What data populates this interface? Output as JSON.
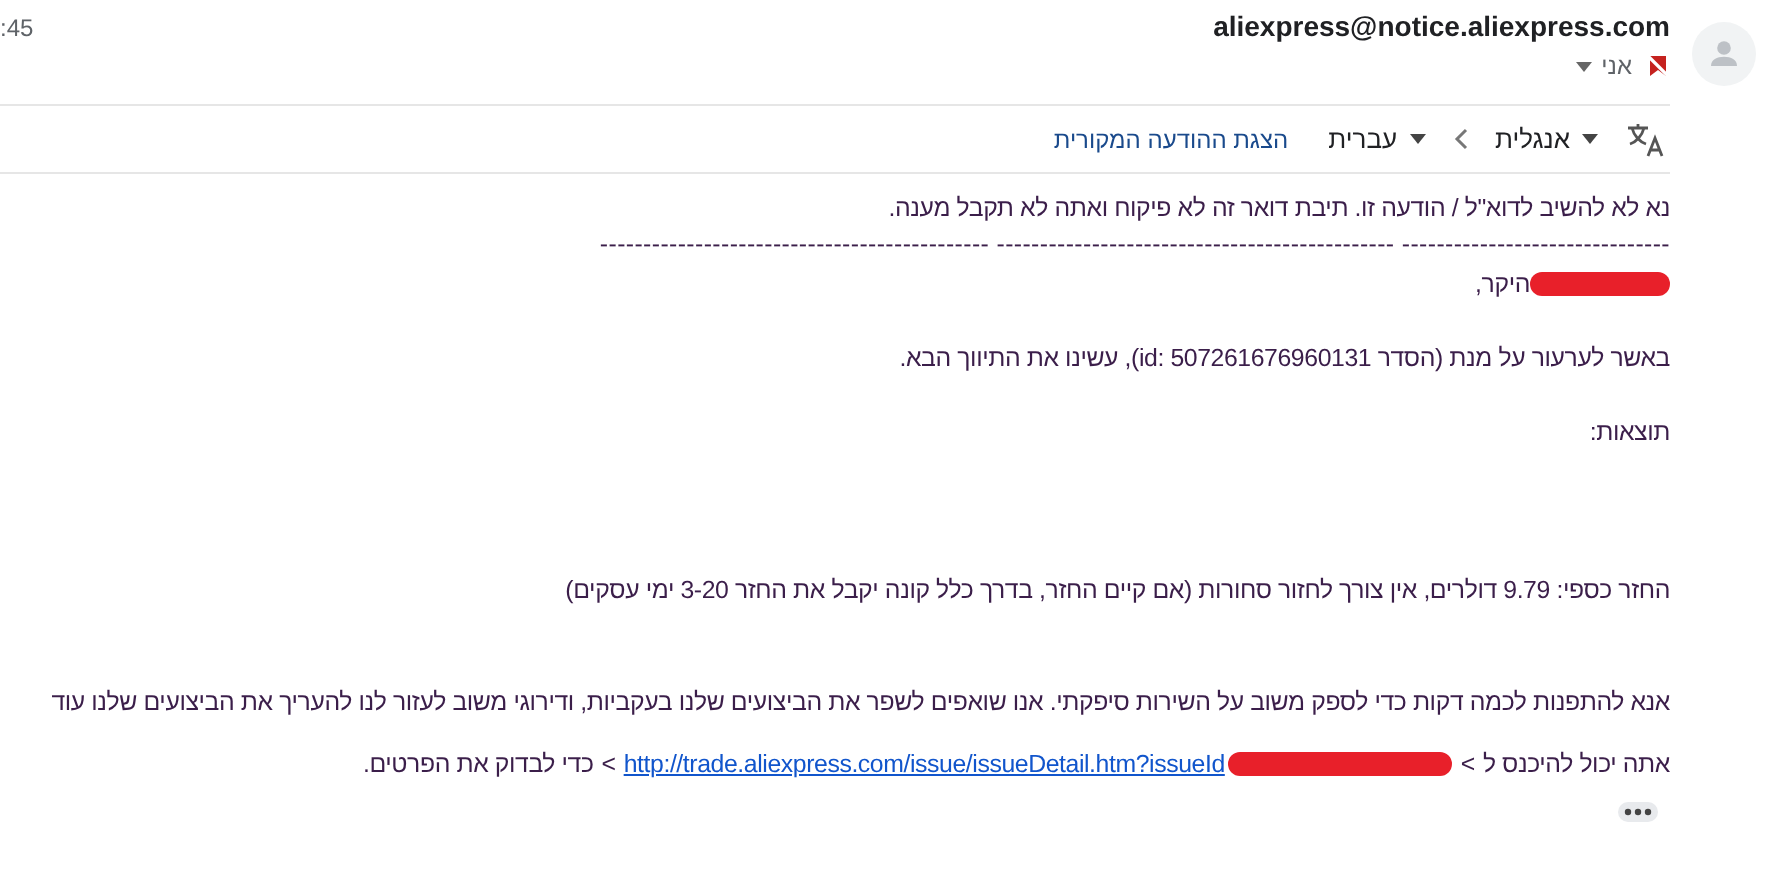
{
  "header": {
    "time": ":45",
    "sender": "aliexpress@notice.aliexpress.com",
    "recipient": "אני"
  },
  "translate_bar": {
    "from_language": "אנגלית",
    "to_language": "עברית",
    "show_original": "הצגת ההודעה המקורית"
  },
  "body": [
    {
      "kind": "text",
      "text": "נא לא להשיב לדוא\"ל / הודעה זו. תיבת דואר זה לא פיקוח ואתה לא תקבל מענה."
    },
    {
      "kind": "rule",
      "text": "--------------------------------------------- ---------------------------------------------- -------------------------------"
    },
    {
      "kind": "text",
      "text": "היקר,",
      "redacted": true
    },
    {
      "kind": "text",
      "text": "באשר לערעור על מנת (הסדר id: 507261676960131), עשינו את התיווך הבא."
    },
    {
      "kind": "text",
      "text": "תוצאות:"
    },
    {
      "kind": "text",
      "text": "החזר כספי: 9.79 דולרים, אין צורך לחזור סחורות (אם קיים החזר, בדרך כלל קונה יקבל את החזר 3-20 ימי עסקים)"
    },
    {
      "kind": "text",
      "text": "אנא להתפנות לכמה דקות כדי לספק משוב על השירות סיפקתי. אנו שואפים לשפר את הביצועים שלנו בעקביות, ודירוגי משוב לעזור לנו להעריך את הביצועים שלנו עוד"
    },
    {
      "kind": "link",
      "before": "אתה יכול להיכנס ל",
      "open_bracket": "<",
      "link": "http://trade.aliexpress.com/issue/issueDetail.htm?issueId",
      "redacted": true,
      "close_bracket": "<",
      "after": "כדי לבדוק את הפרטים."
    }
  ]
}
